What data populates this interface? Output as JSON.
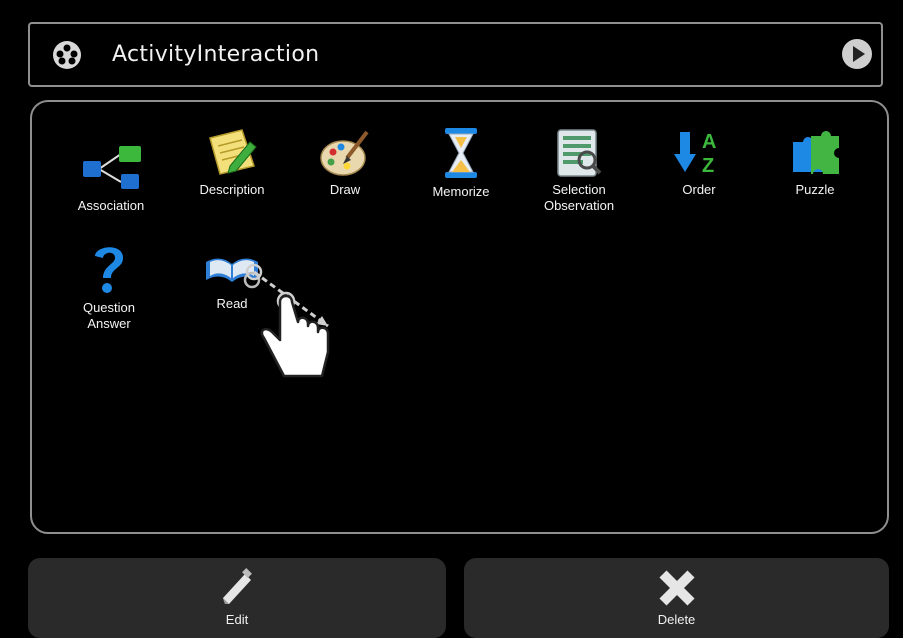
{
  "header": {
    "title": "ActivityInteraction",
    "icon": "palette-reel-icon",
    "next_icon": "play-circle-icon"
  },
  "activities": [
    {
      "label": "Association",
      "icon": "association-icon"
    },
    {
      "label": "Description",
      "icon": "notepad-pencil-icon"
    },
    {
      "label": "Draw",
      "icon": "palette-brush-icon"
    },
    {
      "label": "Memorize",
      "icon": "hourglass-icon"
    },
    {
      "label": "Selection\nObservation",
      "icon": "checklist-magnifier-icon"
    },
    {
      "label": "Order",
      "icon": "sort-az-icon"
    },
    {
      "label": "Puzzle",
      "icon": "puzzle-icon"
    },
    {
      "label": "Question\nAnswer",
      "icon": "question-mark-icon"
    },
    {
      "label": "Read",
      "icon": "book-magnifier-icon"
    }
  ],
  "footer": {
    "edit_label": "Edit",
    "delete_label": "Delete"
  },
  "colors": {
    "background": "#000000",
    "border": "#8f8f8f",
    "button_bg": "#2a2a2a"
  }
}
